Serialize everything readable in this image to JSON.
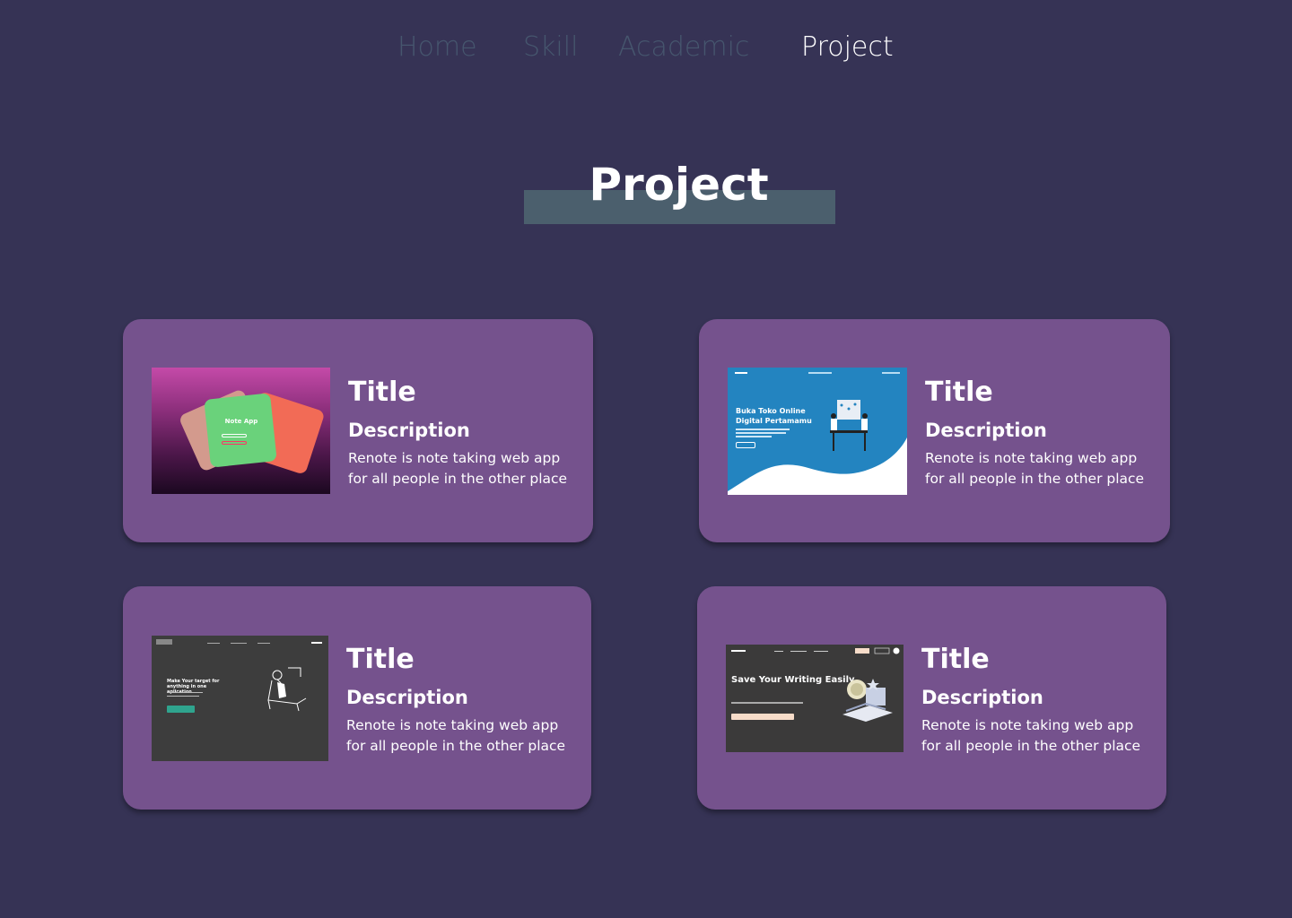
{
  "nav": {
    "items": [
      {
        "label": "Home",
        "active": false
      },
      {
        "label": "Skill",
        "active": false
      },
      {
        "label": "Academic",
        "active": false
      },
      {
        "label": "Project",
        "active": true
      }
    ]
  },
  "section": {
    "heading": "Project"
  },
  "projects": [
    {
      "title": "Title",
      "subtitle": "Description",
      "description": "Renote is note taking web app for all people in the other place",
      "thumbnail_icon": "note-app-preview",
      "thumbnail_text": "Note App"
    },
    {
      "title": "Title",
      "subtitle": "Description",
      "description": "Renote is note taking web app for all people in the other place",
      "thumbnail_icon": "online-store-landing-preview",
      "thumbnail_text": "Buka Toko Online Digital Pertamamu"
    },
    {
      "title": "Title",
      "subtitle": "Description",
      "description": "Renote is note taking web app for all people in the other place",
      "thumbnail_icon": "target-app-landing-preview",
      "thumbnail_text": "Make Your target for anything in one aplication"
    },
    {
      "title": "Title",
      "subtitle": "Description",
      "description": "Renote is note taking web app for all people in the other place",
      "thumbnail_icon": "memo-app-landing-preview",
      "thumbnail_text": "Save Your Writing Easily"
    }
  ],
  "colors": {
    "background": "#363355",
    "card": "#75528d",
    "nav_inactive": "#46566e",
    "nav_active": "#ffffff",
    "heading_bar": "#4b5f6d"
  }
}
